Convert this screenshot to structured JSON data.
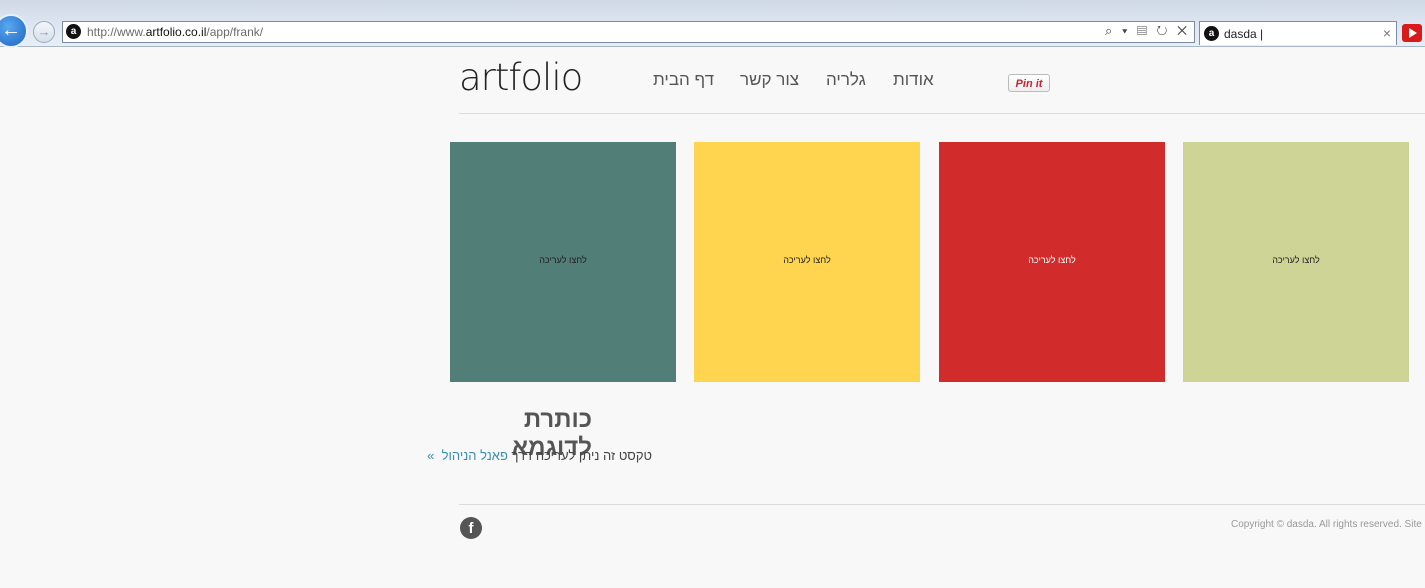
{
  "browser": {
    "back_glyph": "←",
    "forward_glyph": "→",
    "url_prefix": "http://www.",
    "url_domain": "artfolio.co.il",
    "url_path": "/app/frank/",
    "address_tools": "⌕ ▾ ▤ ↻ ✕",
    "tab_title": "dasda |",
    "tab_close": "×",
    "site_icon_letter": "a"
  },
  "header": {
    "logo_text_a": "artf",
    "logo_text_b": "olio",
    "nav": {
      "home": "דף הבית",
      "contact": "צור קשר",
      "gallery": "גלריה",
      "about": "אודות"
    },
    "pinit_label": "Pin it"
  },
  "gallery": {
    "tiles": [
      {
        "caption": "לחצו לעריכה",
        "color": "#517e76"
      },
      {
        "caption": "לחצו לעריכה",
        "color": "#ffd44e"
      },
      {
        "caption": "לחצו לעריכה",
        "color": "#d12c2b"
      },
      {
        "caption": "לחצו לעריכה",
        "color": "#cdd495"
      }
    ]
  },
  "content": {
    "heading": "כותרת לדוגמא",
    "body_text": "טקסט זה ניתן לעריכה דרך ",
    "body_link": "פאנל הניהול",
    "body_marker": "»"
  },
  "footer": {
    "facebook_glyph": "f",
    "copyright": "Copyright © dasda. All rights reserved. Site by Artfolio"
  }
}
